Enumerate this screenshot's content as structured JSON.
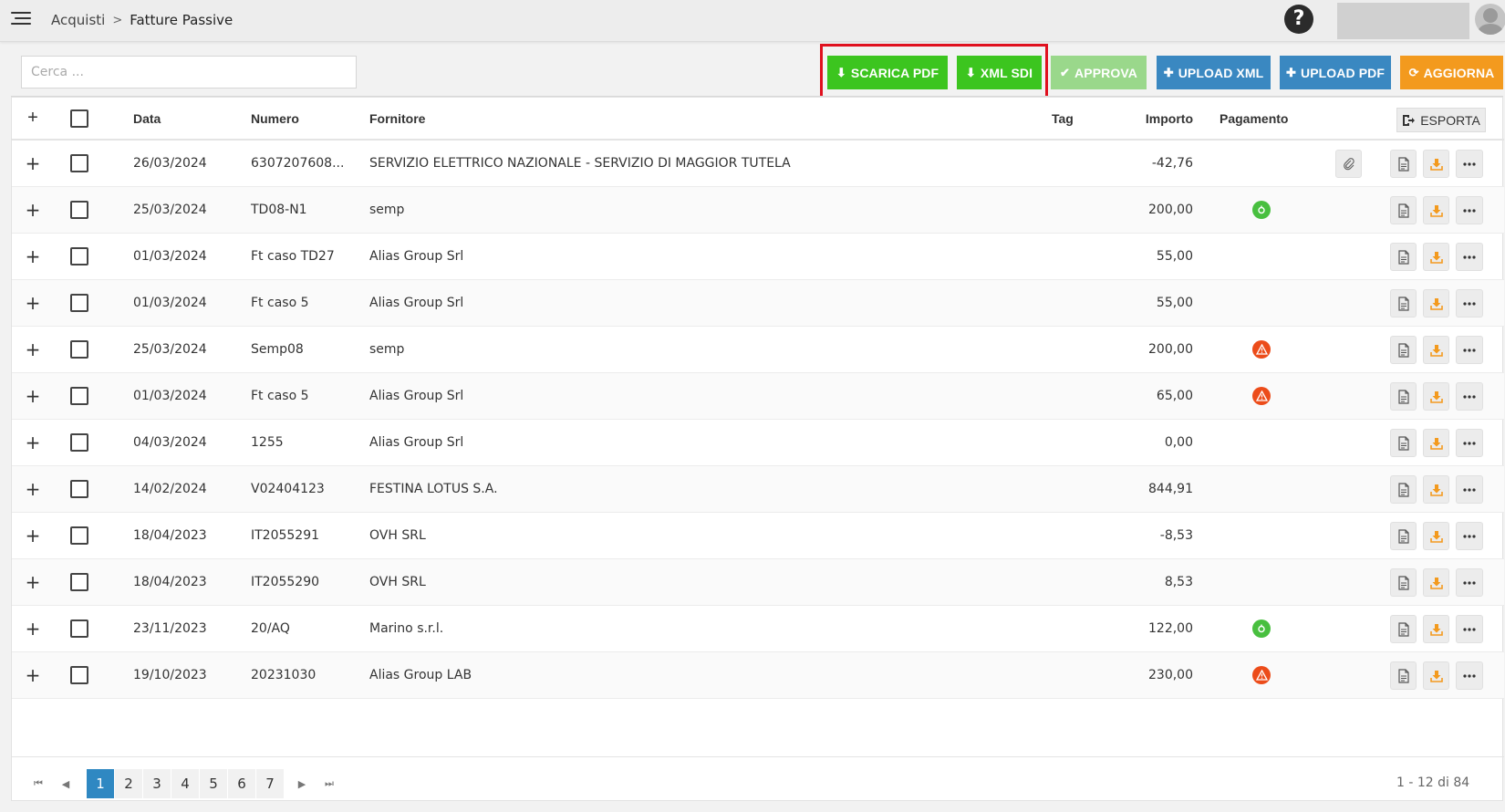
{
  "header": {
    "breadcrumb": [
      "Acquisti",
      "Fatture Passive"
    ],
    "breadcrumb_sep": ">",
    "help_label": "?"
  },
  "toolbar": {
    "search_placeholder": "Cerca ...",
    "buttons": [
      {
        "label": "SCARICA PDF",
        "icon": "download-icon",
        "glyph": "⬇"
      },
      {
        "label": "XML SDI",
        "icon": "download-icon",
        "glyph": "⬇"
      },
      {
        "label": "APPROVA",
        "icon": "check-icon",
        "glyph": "✔"
      },
      {
        "label": "UPLOAD XML",
        "icon": "plus-icon",
        "glyph": "✚"
      },
      {
        "label": "UPLOAD PDF",
        "icon": "plus-icon",
        "glyph": "✚"
      },
      {
        "label": "AGGIORNA",
        "icon": "refresh-icon",
        "glyph": "⟳"
      }
    ]
  },
  "table": {
    "columns": {
      "data": "Data",
      "numero": "Numero",
      "fornitore": "Fornitore",
      "tag": "Tag",
      "importo": "Importo",
      "pagamento": "Pagamento"
    },
    "export_label": "ESPORTA",
    "rows": [
      {
        "data": "26/03/2024",
        "numero": "6307207608...",
        "fornitore": "SERVIZIO ELETTRICO NAZIONALE - SERVIZIO DI MAGGIOR TUTELA",
        "importo": "-42,76",
        "pagamento": "",
        "attachment": true
      },
      {
        "data": "25/03/2024",
        "numero": "TD08-N1",
        "fornitore": "semp",
        "importo": "200,00",
        "pagamento": "ok",
        "attachment": false
      },
      {
        "data": "01/03/2024",
        "numero": "Ft caso TD27",
        "fornitore": "Alias Group Srl",
        "importo": "55,00",
        "pagamento": "",
        "attachment": false
      },
      {
        "data": "01/03/2024",
        "numero": "Ft caso 5",
        "fornitore": "Alias Group Srl",
        "importo": "55,00",
        "pagamento": "",
        "attachment": false
      },
      {
        "data": "25/03/2024",
        "numero": "Semp08",
        "fornitore": "semp",
        "importo": "200,00",
        "pagamento": "warning",
        "attachment": false
      },
      {
        "data": "01/03/2024",
        "numero": "Ft caso 5",
        "fornitore": "Alias Group Srl",
        "importo": "65,00",
        "pagamento": "warning",
        "attachment": false
      },
      {
        "data": "04/03/2024",
        "numero": "1255",
        "fornitore": "Alias Group Srl",
        "importo": "0,00",
        "pagamento": "",
        "attachment": false
      },
      {
        "data": "14/02/2024",
        "numero": "V02404123",
        "fornitore": "FESTINA LOTUS S.A.",
        "importo": "844,91",
        "pagamento": "",
        "attachment": false
      },
      {
        "data": "18/04/2023",
        "numero": "IT2055291",
        "fornitore": "OVH SRL",
        "importo": "-8,53",
        "pagamento": "",
        "attachment": false
      },
      {
        "data": "18/04/2023",
        "numero": "IT2055290",
        "fornitore": "OVH SRL",
        "importo": "8,53",
        "pagamento": "",
        "attachment": false
      },
      {
        "data": "23/11/2023",
        "numero": "20/AQ",
        "fornitore": "Marino s.r.l.",
        "importo": "122,00",
        "pagamento": "ok",
        "attachment": false
      },
      {
        "data": "19/10/2023",
        "numero": "20231030",
        "fornitore": "Alias Group LAB",
        "importo": "230,00",
        "pagamento": "warning",
        "attachment": false
      }
    ]
  },
  "pagination": {
    "pages": [
      "1",
      "2",
      "3",
      "4",
      "5",
      "6",
      "7"
    ],
    "current": "1",
    "info": "1 - 12 di 84"
  },
  "colors": {
    "green": "#3cc51f",
    "green_disabled": "#9ad88b",
    "blue": "#3a88c1",
    "orange": "#f39a1e",
    "highlight": "#e0101e",
    "status_ok": "#48bf3f",
    "status_warning": "#ec4c1a"
  }
}
